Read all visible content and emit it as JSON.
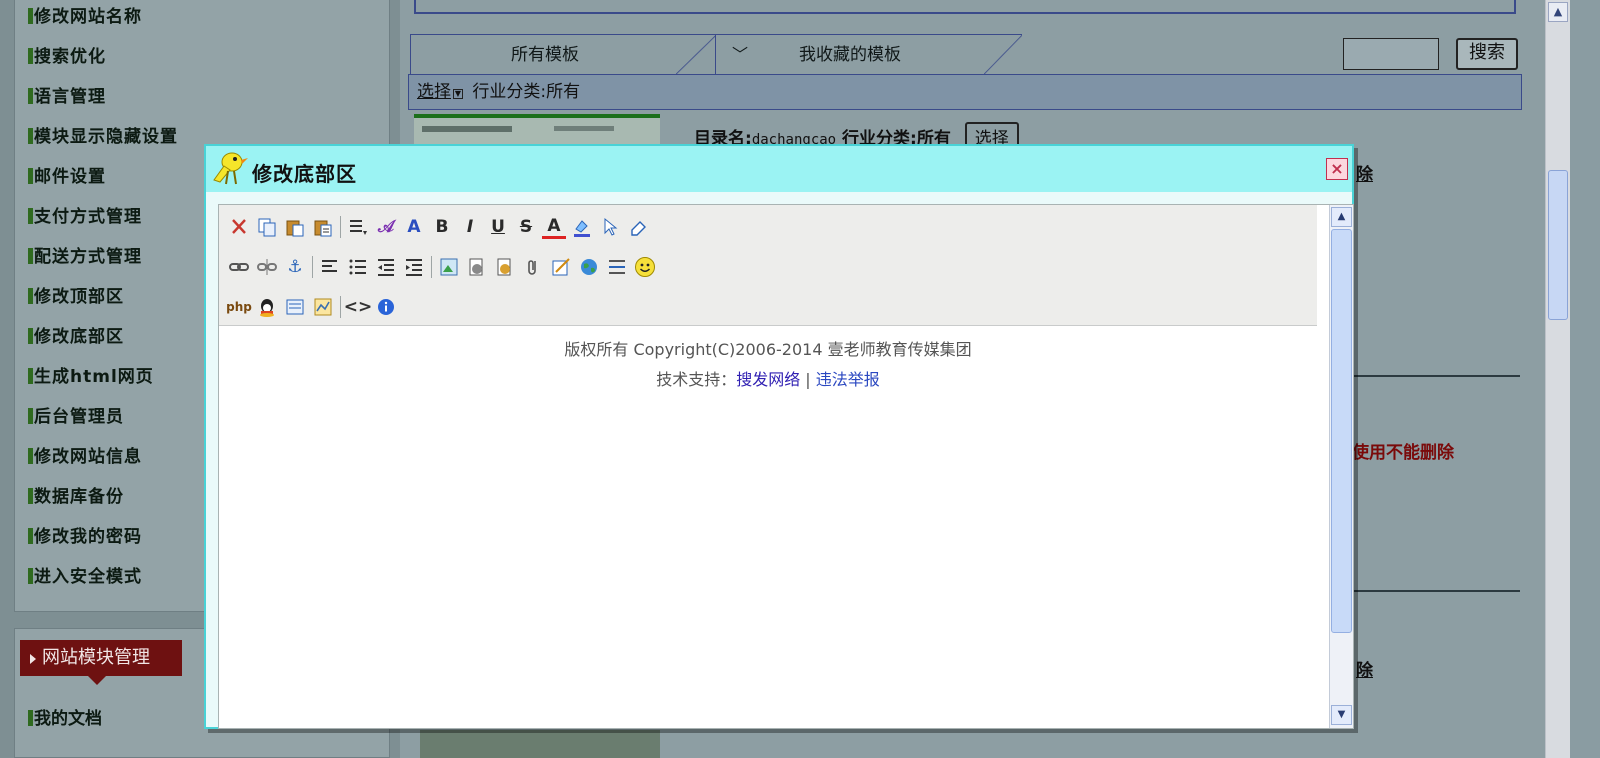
{
  "sidebar": {
    "items": [
      {
        "label": "修改网站名称"
      },
      {
        "label": "搜索优化"
      },
      {
        "label": "语言管理"
      },
      {
        "label": "模块显示隐藏设置"
      },
      {
        "label": "邮件设置"
      },
      {
        "label": "支付方式管理"
      },
      {
        "label": "配送方式管理"
      },
      {
        "label": "修改顶部区"
      },
      {
        "label": "修改底部区"
      },
      {
        "label": "生成html网页"
      },
      {
        "label": "后台管理员"
      },
      {
        "label": "修改网站信息"
      },
      {
        "label": "数据库备份"
      },
      {
        "label": "修改我的密码"
      },
      {
        "label": "进入安全模式"
      }
    ],
    "module_header": "网站模块管理",
    "module_items": [
      {
        "label": "我的文档"
      }
    ]
  },
  "main": {
    "tabs": [
      {
        "label": "所有模板"
      },
      {
        "label": "我收藏的模板"
      }
    ],
    "search": {
      "value": "",
      "button_label": "搜索"
    },
    "filter": {
      "select_label": "选择",
      "category_text": "行业分类:所有"
    },
    "template_row": {
      "dir_label": "目录名:",
      "dir_value": "dachangcao",
      "category_text": "行业分类:所有",
      "select_button": "选择"
    },
    "right_fragments": {
      "frag1": "除",
      "red_note": "使用不能删除",
      "frag2": "除"
    }
  },
  "modal": {
    "title": "修改底部区",
    "close_label": "×",
    "toolbar": {
      "row1": [
        "cut-icon",
        "copy-icon",
        "paste-icon",
        "paste-text-icon",
        "|",
        "format-icon",
        "font-family-icon",
        "font-size-icon",
        "bold-icon",
        "italic-icon",
        "underline-icon",
        "strikethrough-icon",
        "text-color-icon",
        "highlight-icon",
        "select-icon",
        "eraser-icon"
      ],
      "row2": [
        "link-icon",
        "unlink-icon",
        "anchor-icon",
        "|",
        "align-left-icon",
        "list-icon",
        "outdent-icon",
        "indent-icon",
        "|",
        "image-icon",
        "flash-icon",
        "media-icon",
        "attachment-icon",
        "edit-table-icon",
        "globe-icon",
        "hr-icon",
        "emoticon-icon"
      ],
      "row3": [
        "php-icon",
        "qq-icon",
        "template-icon",
        "map-icon",
        "|",
        "source-code-icon",
        "about-icon"
      ],
      "glyphs": {
        "bold": "B",
        "italic": "I",
        "underline": "U",
        "strike": "S",
        "textcolor": "A"
      }
    },
    "content": {
      "line1": "版权所有 Copyright(C)2006-2014 壹老师教育传媒集团",
      "line2_prefix": "技术支持：",
      "link1": "搜发网络",
      "separator": " | ",
      "link2": "违法举报"
    }
  },
  "colors": {
    "modal_title_bg": "#9bf3f3",
    "module_header_bg": "#6e1111",
    "red_note": "#7a0a0a",
    "link1": "#2f1fb2",
    "link2": "#2a47c0"
  }
}
